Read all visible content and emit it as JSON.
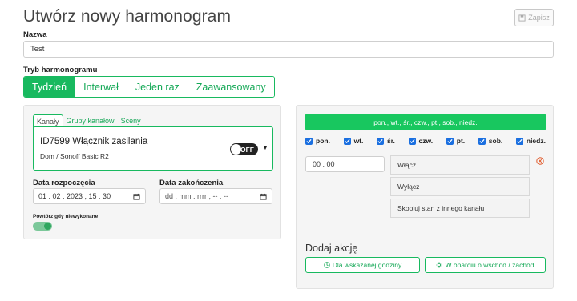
{
  "header": {
    "title": "Utwórz nowy harmonogram",
    "save_label": "Zapisz"
  },
  "name_field": {
    "label": "Nazwa",
    "value": "Test"
  },
  "mode": {
    "label": "Tryb harmonogramu",
    "options": [
      "Tydzień",
      "Interwał",
      "Jeden raz",
      "Zaawansowany"
    ],
    "selected": "Tydzień"
  },
  "left": {
    "tabs": [
      "Kanały",
      "Grupy kanałów",
      "Sceny"
    ],
    "channel": {
      "name": "ID7599 Włącznik zasilania",
      "subtitle": "Dom / Sonoff Basic R2",
      "state": "OFF"
    },
    "start": {
      "label": "Data rozpoczęcia",
      "value": "01 . 02 . 2023 ,  15 : 30"
    },
    "end": {
      "label": "Data zakończenia",
      "value": "dd . mm . rrrr ,  -- : --"
    },
    "repeat_label": "Powtórz gdy niewykonane"
  },
  "right": {
    "days_summary": "pon., wt., śr., czw., pt., sob., niedz.",
    "days": [
      "pon.",
      "wt.",
      "śr.",
      "czw.",
      "pt.",
      "sob.",
      "niedz."
    ],
    "time": "00 : 00",
    "actions": [
      "Włącz",
      "Wyłącz",
      "Skopiuj stan z innego kanału"
    ],
    "add_title": "Dodaj akcję",
    "add_buttons": [
      "Dla wskazanej godziny",
      "W oparciu o wschód / zachód"
    ]
  },
  "colors": {
    "accent": "#18b95f",
    "checkbox": "#1a6fe0",
    "remove": "#e05a2b"
  }
}
